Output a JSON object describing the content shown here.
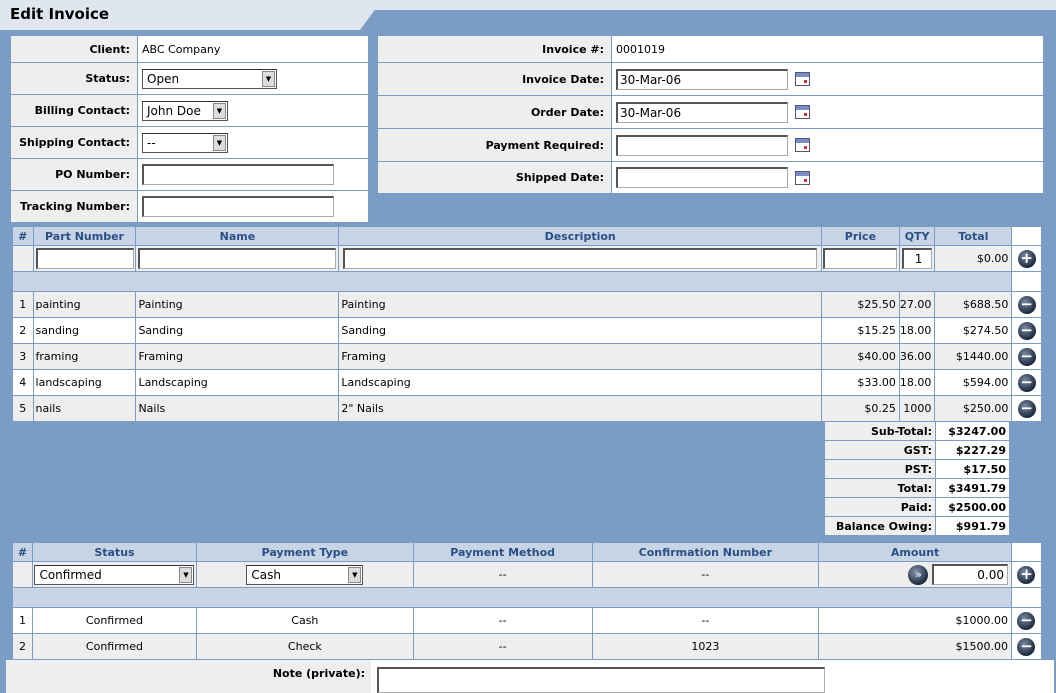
{
  "page": {
    "title": "Edit Invoice"
  },
  "left_form": {
    "client_label": "Client:",
    "client_value": "ABC Company",
    "status_label": "Status:",
    "status_value": "Open",
    "billing_label": "Billing Contact:",
    "billing_value": "John Doe",
    "shipping_label": "Shipping Contact:",
    "shipping_value": "--",
    "po_label": "PO Number:",
    "po_value": "",
    "tracking_label": "Tracking Number:",
    "tracking_value": ""
  },
  "right_form": {
    "invoice_label": "Invoice #:",
    "invoice_value": "0001019",
    "invoice_date_label": "Invoice Date:",
    "invoice_date_value": "30-Mar-06",
    "order_date_label": "Order Date:",
    "order_date_value": "30-Mar-06",
    "payment_required_label": "Payment Required:",
    "payment_required_value": "",
    "shipped_date_label": "Shipped Date:",
    "shipped_date_value": ""
  },
  "items": {
    "headers": {
      "num": "#",
      "part": "Part Number",
      "name": "Name",
      "desc": "Description",
      "price": "Price",
      "qty": "QTY",
      "total": "Total"
    },
    "entry": {
      "part": "",
      "name": "",
      "desc": "",
      "price": "",
      "qty": "1",
      "total": "$0.00"
    },
    "rows": [
      {
        "num": "1",
        "part": "painting",
        "name": "Painting",
        "desc": "Painting",
        "price": "$25.50",
        "qty": "27.00",
        "total": "$688.50"
      },
      {
        "num": "2",
        "part": "sanding",
        "name": "Sanding",
        "desc": "Sanding",
        "price": "$15.25",
        "qty": "18.00",
        "total": "$274.50"
      },
      {
        "num": "3",
        "part": "framing",
        "name": "Framing",
        "desc": "Framing",
        "price": "$40.00",
        "qty": "36.00",
        "total": "$1440.00"
      },
      {
        "num": "4",
        "part": "landscaping",
        "name": "Landscaping",
        "desc": "Landscaping",
        "price": "$33.00",
        "qty": "18.00",
        "total": "$594.00"
      },
      {
        "num": "5",
        "part": "nails",
        "name": "Nails",
        "desc": "2\" Nails",
        "price": "$0.25",
        "qty": "1000",
        "total": "$250.00"
      }
    ]
  },
  "totals": [
    {
      "label": "Sub-Total:",
      "value": "$3247.00"
    },
    {
      "label": "GST:",
      "value": "$227.29"
    },
    {
      "label": "PST:",
      "value": "$17.50"
    },
    {
      "label": "Total:",
      "value": "$3491.79"
    },
    {
      "label": "Paid:",
      "value": "$2500.00"
    },
    {
      "label": "Balance Owing:",
      "value": "$991.79"
    }
  ],
  "payments": {
    "headers": {
      "num": "#",
      "status": "Status",
      "type": "Payment Type",
      "method": "Payment Method",
      "confirmation": "Confirmation Number",
      "amount": "Amount"
    },
    "entry": {
      "status": "Confirmed",
      "type": "Cash",
      "method": "--",
      "confirmation": "--",
      "amount": "0.00"
    },
    "rows": [
      {
        "num": "1",
        "status": "Confirmed",
        "type": "Cash",
        "method": "--",
        "confirmation": "--",
        "amount": "$1000.00"
      },
      {
        "num": "2",
        "status": "Confirmed",
        "type": "Check",
        "method": "--",
        "confirmation": "1023",
        "amount": "$1500.00"
      }
    ]
  },
  "note": {
    "label": "Note (private):",
    "value": ""
  },
  "icons": {
    "add": "+",
    "remove": "−",
    "forward": "»",
    "dropdown": "▼"
  }
}
